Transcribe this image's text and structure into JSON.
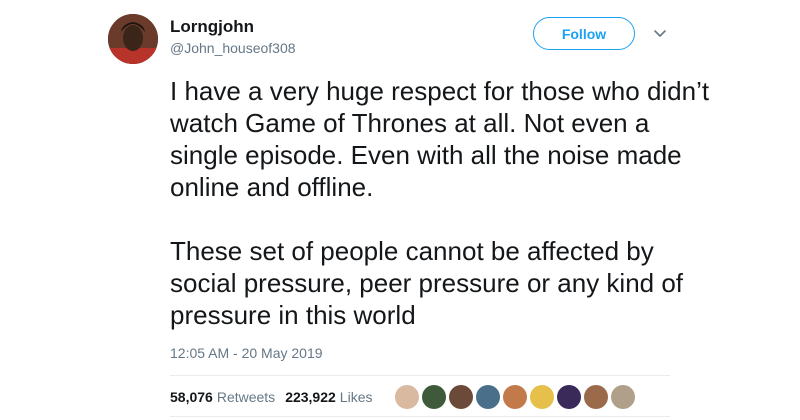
{
  "tweet": {
    "display_name": "Lorngjohn",
    "handle": "@John_houseof308",
    "follow_label": "Follow",
    "text": "I have a very huge respect for those who didn’t watch Game of Thrones at all. Not even a single episode. Even with all the noise made online and offline.\n\nThese set of people cannot be affected by social pressure, peer pressure or any kind of pressure in this world",
    "timestamp": "12:05 AM - 20 May 2019",
    "retweets_count": "58,076",
    "retweets_label": "Retweets",
    "likes_count": "223,922",
    "likes_label": "Likes"
  },
  "colors": {
    "accent": "#1da1f2",
    "secondary_text": "#657786",
    "primary_text": "#14171a",
    "divider": "#e6ecf0"
  },
  "icons": {
    "menu": "chevron-down-icon"
  },
  "liker_avatar_colors": [
    "#d9b9a0",
    "#3f5a3a",
    "#6b4a3a",
    "#4a6f8a",
    "#c27a4a",
    "#e6c04a",
    "#3a2a5a",
    "#9a6a4a",
    "#b0a08a"
  ]
}
